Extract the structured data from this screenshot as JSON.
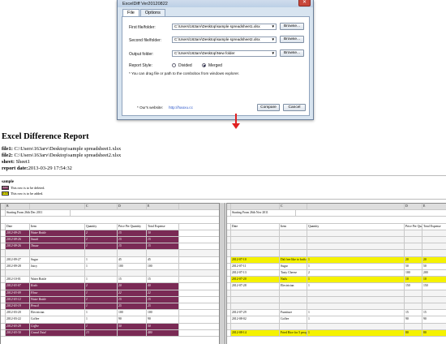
{
  "dialog": {
    "title": "ExcelDiff Ver20120822",
    "tabs": [
      "File",
      "Options"
    ],
    "first_label": "First file/folder:",
    "first_value": "C:\\Users\\163arv\\Desktop\\sample spreadsheet1.xlsx",
    "second_label": "Second file/folder:",
    "second_value": "C:\\Users\\163arv\\Desktop\\sample spreadsheet2.xlsx",
    "output_label": "Output folder:",
    "output_value": "C:\\Users\\163arv\\Desktop\\New folder",
    "browse": "Browse...",
    "style_label": "Report Style:",
    "divided": "Divided",
    "merged": "Merged",
    "selected_style": "Merged",
    "drag_hint": "* You can drag file or path to the combobox from windows explorer.",
    "website_label": "* Our's website:",
    "website_url": "http://haoxu.cc",
    "compare": "Compare",
    "cancel": "Cancel"
  },
  "report": {
    "title": "Excel Difference Report",
    "file1_label": "file1:",
    "file1_value": " C:\\Users\\163arv\\Desktop\\sample spreadsheet1.xlsx",
    "file2_label": "file2:",
    "file2_value": " C:\\Users\\163arv\\Desktop\\sample spreadsheet2.xlsx",
    "sheet_label": "sheet:",
    "sheet_value": " Sheet1",
    "date_label": "report date:",
    "date_value": "2013-03-29 17:54:32",
    "sample_label": "sample",
    "legend_deleted_code": "ZZZ",
    "legend_deleted": "This row is to be deleted.",
    "legend_added_code": "AAA",
    "legend_added": "This row is to be added.",
    "colors": {
      "deleted": "#7a2a55",
      "added": "#f5f200"
    }
  },
  "left_table": {
    "col_letters": [
      "",
      "B",
      "",
      "C",
      "D",
      "E"
    ],
    "caption": "Starting From 26th Dec 2011",
    "headers": [
      "Date",
      "Item",
      "Quantity",
      "Price Per Quantity",
      "Total Expense"
    ],
    "rows": [
      {
        "style": "m",
        "cells": [
          "2012-09-25",
          "Water Bottle",
          "2",
          "15",
          "30"
        ]
      },
      {
        "style": "m",
        "cells": [
          "2012-09-26",
          "Snack",
          "1",
          "15",
          "15"
        ]
      },
      {
        "style": "m",
        "cells": [
          "2012-09-26",
          "Tissue",
          "1",
          "15",
          "15"
        ]
      },
      {
        "style": "blank",
        "cells": [
          "",
          "",
          "",
          "",
          ""
        ]
      },
      {
        "style": "",
        "cells": [
          "2012-09-27",
          "Sugar",
          "1",
          "45",
          "45"
        ]
      },
      {
        "style": "",
        "cells": [
          "2012-09-28",
          "Juicy",
          "1",
          "100",
          "100"
        ]
      },
      {
        "style": "blank",
        "cells": [
          "",
          "",
          "",
          "",
          ""
        ]
      },
      {
        "style": "",
        "cells": [
          "2012-10-01",
          "Water Bottle",
          "1",
          "15",
          "15"
        ]
      },
      {
        "style": "m",
        "cells": [
          "2012-03-07",
          "Kodo",
          "2",
          "20",
          "40"
        ]
      },
      {
        "style": "m",
        "cells": [
          "2012-03-09",
          "Flour",
          "1",
          "22",
          "22"
        ]
      },
      {
        "style": "m",
        "cells": [
          "2012-03-12",
          "Water Bottle",
          "1",
          "15",
          "15"
        ]
      },
      {
        "style": "m",
        "cells": [
          "2012-03-19",
          "Pencil",
          "1",
          "25",
          "25"
        ]
      },
      {
        "style": "",
        "cells": [
          "2012-03-20",
          "Electrician",
          "1",
          "100",
          "100"
        ]
      },
      {
        "style": "",
        "cells": [
          "2012-03-22",
          "Coffee",
          "1",
          "90",
          "90"
        ]
      },
      {
        "style": "m",
        "cells": [
          "2012-03-29",
          "Coffee",
          "1",
          "50",
          "50"
        ]
      },
      {
        "style": "m",
        "cells": [
          "2012-03-30",
          "Grand Total",
          "13",
          "",
          "480"
        ]
      }
    ]
  },
  "right_table": {
    "col_letters": [
      "",
      "",
      "C",
      "",
      "D",
      "E"
    ],
    "caption": "Starting From 26th Nov 2011",
    "headers": [
      "Date",
      "Item",
      "Quantity",
      "Price Per Quantity",
      "Total Expense"
    ],
    "rows": [
      {
        "style": "blank",
        "cells": [
          "",
          "",
          "",
          "",
          ""
        ]
      },
      {
        "style": "blank",
        "cells": [
          "",
          "",
          "",
          "",
          ""
        ]
      },
      {
        "style": "blank",
        "cells": [
          "",
          "",
          "",
          "",
          ""
        ]
      },
      {
        "style": "blank",
        "cells": [
          "",
          "",
          "",
          "",
          ""
        ]
      },
      {
        "style": "y",
        "cells": [
          "2012-07-10",
          "Dal free like to both expense",
          "1",
          "20",
          "20"
        ]
      },
      {
        "style": "",
        "cells": [
          "2012-07-11",
          "Sugar",
          "1",
          "50",
          "50"
        ]
      },
      {
        "style": "",
        "cells": [
          "2012-07-13",
          "Tasty Cheese",
          "2",
          "100",
          "200"
        ]
      },
      {
        "style": "y",
        "cells": [
          "2012-07-20",
          "Nails",
          "1",
          "10",
          "10"
        ]
      },
      {
        "style": "",
        "cells": [
          "2012-07-28",
          "Electrician",
          "1",
          "150",
          "150"
        ]
      },
      {
        "style": "blank",
        "cells": [
          "",
          "",
          "",
          "",
          ""
        ]
      },
      {
        "style": "blank",
        "cells": [
          "",
          "",
          "",
          "",
          ""
        ]
      },
      {
        "style": "blank",
        "cells": [
          "",
          "",
          "",
          "",
          ""
        ]
      },
      {
        "style": "",
        "cells": [
          "2012-07-29",
          "Furniture",
          "1",
          "15",
          "15"
        ]
      },
      {
        "style": "",
        "cells": [
          "2012-08-02",
          "Coffee",
          "1",
          "90",
          "90"
        ]
      },
      {
        "style": "blank",
        "cells": [
          "",
          "",
          "",
          "",
          ""
        ]
      },
      {
        "style": "y",
        "cells": [
          "2012-08-14",
          "Fried Rice for 5 people",
          "1",
          "80",
          "80"
        ]
      }
    ]
  }
}
